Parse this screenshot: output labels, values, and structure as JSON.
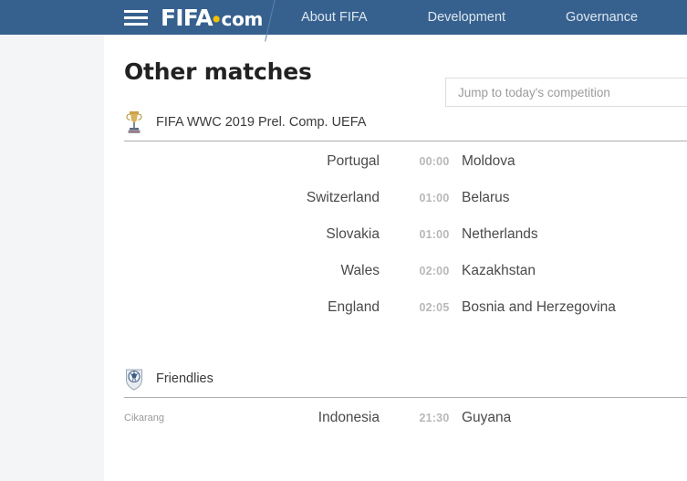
{
  "topbar": {
    "menu_icon": "hamburger-menu-icon",
    "brand": {
      "main": "FIFA",
      "dot": "•",
      "suffix": "com"
    },
    "links": [
      {
        "label": "About FIFA"
      },
      {
        "label": "Development"
      },
      {
        "label": "Governance"
      }
    ],
    "background_color": "#36618f",
    "accent_color": "#f2c200"
  },
  "page": {
    "title": "Other matches"
  },
  "search": {
    "placeholder": "Jump to today's competition",
    "value": ""
  },
  "competitions": [
    {
      "icon": "trophy-icon",
      "name": "FIFA WWC 2019 Prel. Comp. UEFA",
      "matches": [
        {
          "venue": "",
          "home": "Portugal",
          "time": "00:00",
          "away": "Moldova"
        },
        {
          "venue": "",
          "home": "Switzerland",
          "time": "01:00",
          "away": "Belarus"
        },
        {
          "venue": "",
          "home": "Slovakia",
          "time": "01:00",
          "away": "Netherlands"
        },
        {
          "venue": "",
          "home": "Wales",
          "time": "02:00",
          "away": "Kazakhstan"
        },
        {
          "venue": "",
          "home": "England",
          "time": "02:05",
          "away": "Bosnia and Herzegovina"
        }
      ]
    },
    {
      "icon": "football-shield-icon",
      "name": "Friendlies",
      "matches": [
        {
          "venue": "Cikarang",
          "home": "Indonesia",
          "time": "21:30",
          "away": "Guyana"
        }
      ]
    }
  ]
}
